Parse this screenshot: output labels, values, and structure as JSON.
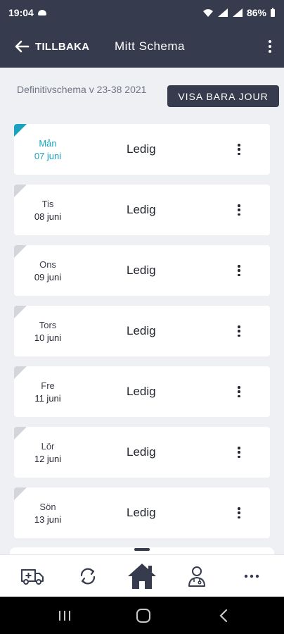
{
  "status_bar": {
    "time": "19:04",
    "battery": "86%"
  },
  "header": {
    "back_label": "TILLBAKA",
    "title": "Mitt Schema"
  },
  "schema": {
    "title": "Definitivschema v 23-38 2021",
    "jour_button": "VISA BARA JOUR"
  },
  "days": [
    {
      "day": "Mån",
      "date": "07 juni",
      "status": "Ledig"
    },
    {
      "day": "Tis",
      "date": "08 juni",
      "status": "Ledig"
    },
    {
      "day": "Ons",
      "date": "09 juni",
      "status": "Ledig"
    },
    {
      "day": "Tors",
      "date": "10 juni",
      "status": "Ledig"
    },
    {
      "day": "Fre",
      "date": "11 juni",
      "status": "Ledig"
    },
    {
      "day": "Lör",
      "date": "12 juni",
      "status": "Ledig"
    },
    {
      "day": "Sön",
      "date": "13 juni",
      "status": "Ledig"
    }
  ],
  "colors": {
    "header_bg": "#363b4d",
    "accent": "#1aa3c0",
    "background": "#eef0f4"
  },
  "bottom_nav": [
    "ambulance-icon",
    "sync-icon",
    "home-icon",
    "doctor-icon",
    "more-icon"
  ]
}
